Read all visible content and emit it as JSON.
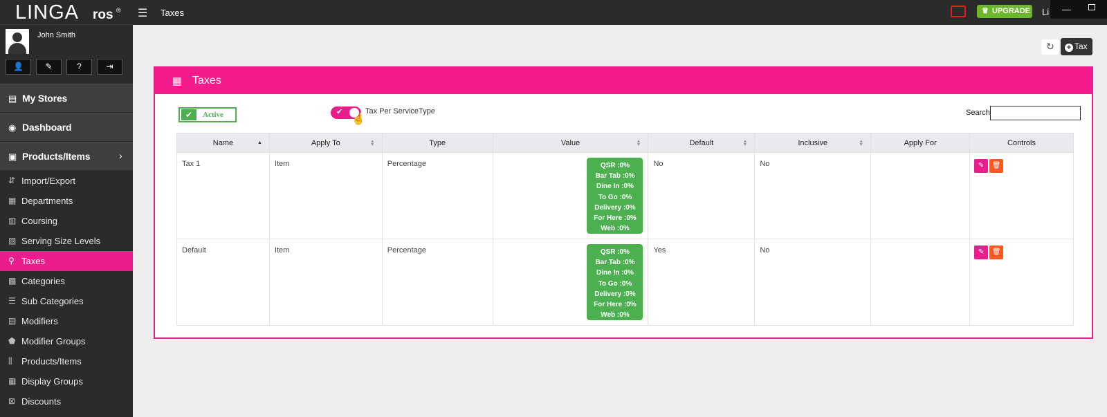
{
  "app": {
    "logo_main": "LINGA",
    "logo_suffix": "ros",
    "logo_reg": "®",
    "page_title": "Taxes",
    "upgrade_label": "UPGRADE",
    "user_top": "Li"
  },
  "profile": {
    "name": "John Smith"
  },
  "sidebar": {
    "main": [
      {
        "label": "My Stores"
      },
      {
        "label": "Dashboard"
      },
      {
        "label": "Products/Items"
      }
    ],
    "sub": [
      {
        "label": "Import/Export"
      },
      {
        "label": "Departments"
      },
      {
        "label": "Coursing"
      },
      {
        "label": "Serving Size Levels"
      },
      {
        "label": "Taxes"
      },
      {
        "label": "Categories"
      },
      {
        "label": "Sub Categories"
      },
      {
        "label": "Modifiers"
      },
      {
        "label": "Modifier Groups"
      },
      {
        "label": "Products/Items"
      },
      {
        "label": "Display Groups"
      },
      {
        "label": "Discounts"
      }
    ]
  },
  "toolbar": {
    "add_label": "Tax"
  },
  "panel": {
    "title": "Taxes",
    "active_label": "Active",
    "toggle_label": "Tax Per ServiceType",
    "search_label": "Search",
    "search_value": ""
  },
  "table": {
    "headers": [
      "Name",
      "Apply To",
      "Type",
      "Value",
      "Default",
      "Inclusive",
      "Apply For",
      "Controls"
    ],
    "rows": [
      {
        "name": "Tax 1",
        "apply_to": "Item",
        "type": "Percentage",
        "values": [
          "QSR :0%",
          "Bar Tab :0%",
          "Dine In :0%",
          "To Go :0%",
          "Delivery :0%",
          "For Here :0%",
          "Web :0%"
        ],
        "default": "No",
        "inclusive": "No",
        "apply_for": ""
      },
      {
        "name": "Default",
        "apply_to": "Item",
        "type": "Percentage",
        "values": [
          "QSR :0%",
          "Bar Tab :0%",
          "Dine In :0%",
          "To Go :0%",
          "Delivery :0%",
          "For Here :0%",
          "Web :0%"
        ],
        "default": "Yes",
        "inclusive": "No",
        "apply_for": ""
      }
    ]
  },
  "colors": {
    "accent": "#e91e8c",
    "sidebar_bg": "#2b2b2b",
    "success": "#4caf50",
    "danger": "#ff5722",
    "upgrade": "#6cb52d"
  }
}
